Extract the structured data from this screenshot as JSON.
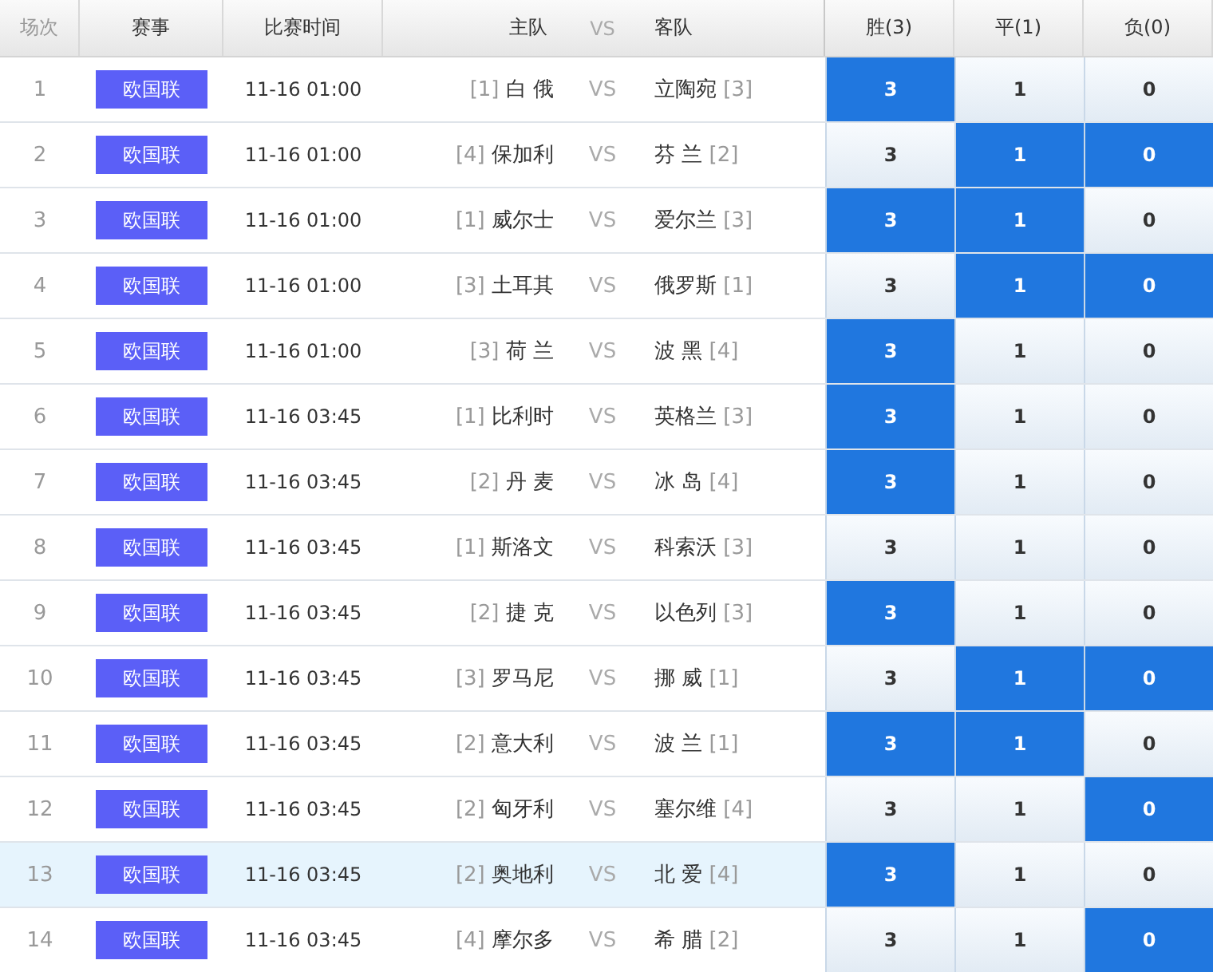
{
  "columns": [
    "场次",
    "赛事",
    "比赛时间",
    "主队",
    "VS",
    "客队",
    "胜(3)",
    "平(1)",
    "负(0)"
  ],
  "rows": [
    {
      "no": "1",
      "league": "欧国联",
      "time": "11-16 01:00",
      "home_rank": "[1]",
      "home": "白 俄",
      "vs": "VS",
      "away": "立陶宛",
      "away_rank": "[3]",
      "selected": false,
      "odds": [
        {
          "label": "3",
          "selected": true
        },
        {
          "label": "1",
          "selected": false
        },
        {
          "label": "0",
          "selected": false
        }
      ]
    },
    {
      "no": "2",
      "league": "欧国联",
      "time": "11-16 01:00",
      "home_rank": "[4]",
      "home": "保加利",
      "vs": "VS",
      "away": "芬 兰",
      "away_rank": "[2]",
      "selected": false,
      "odds": [
        {
          "label": "3",
          "selected": false
        },
        {
          "label": "1",
          "selected": true
        },
        {
          "label": "0",
          "selected": true
        }
      ]
    },
    {
      "no": "3",
      "league": "欧国联",
      "time": "11-16 01:00",
      "home_rank": "[1]",
      "home": "威尔士",
      "vs": "VS",
      "away": "爱尔兰",
      "away_rank": "[3]",
      "selected": false,
      "odds": [
        {
          "label": "3",
          "selected": true
        },
        {
          "label": "1",
          "selected": true
        },
        {
          "label": "0",
          "selected": false
        }
      ]
    },
    {
      "no": "4",
      "league": "欧国联",
      "time": "11-16 01:00",
      "home_rank": "[3]",
      "home": "土耳其",
      "vs": "VS",
      "away": "俄罗斯",
      "away_rank": "[1]",
      "selected": false,
      "odds": [
        {
          "label": "3",
          "selected": false
        },
        {
          "label": "1",
          "selected": true
        },
        {
          "label": "0",
          "selected": true
        }
      ]
    },
    {
      "no": "5",
      "league": "欧国联",
      "time": "11-16 01:00",
      "home_rank": "[3]",
      "home": "荷 兰",
      "vs": "VS",
      "away": "波 黑",
      "away_rank": "[4]",
      "selected": false,
      "odds": [
        {
          "label": "3",
          "selected": true
        },
        {
          "label": "1",
          "selected": false
        },
        {
          "label": "0",
          "selected": false
        }
      ]
    },
    {
      "no": "6",
      "league": "欧国联",
      "time": "11-16 03:45",
      "home_rank": "[1]",
      "home": "比利时",
      "vs": "VS",
      "away": "英格兰",
      "away_rank": "[3]",
      "selected": false,
      "odds": [
        {
          "label": "3",
          "selected": true
        },
        {
          "label": "1",
          "selected": false
        },
        {
          "label": "0",
          "selected": false
        }
      ]
    },
    {
      "no": "7",
      "league": "欧国联",
      "time": "11-16 03:45",
      "home_rank": "[2]",
      "home": "丹 麦",
      "vs": "VS",
      "away": "冰 岛",
      "away_rank": "[4]",
      "selected": false,
      "odds": [
        {
          "label": "3",
          "selected": true
        },
        {
          "label": "1",
          "selected": false
        },
        {
          "label": "0",
          "selected": false
        }
      ]
    },
    {
      "no": "8",
      "league": "欧国联",
      "time": "11-16 03:45",
      "home_rank": "[1]",
      "home": "斯洛文",
      "vs": "VS",
      "away": "科索沃",
      "away_rank": "[3]",
      "selected": false,
      "odds": [
        {
          "label": "3",
          "selected": false
        },
        {
          "label": "1",
          "selected": false
        },
        {
          "label": "0",
          "selected": false
        }
      ]
    },
    {
      "no": "9",
      "league": "欧国联",
      "time": "11-16 03:45",
      "home_rank": "[2]",
      "home": "捷 克",
      "vs": "VS",
      "away": "以色列",
      "away_rank": "[3]",
      "selected": false,
      "odds": [
        {
          "label": "3",
          "selected": true
        },
        {
          "label": "1",
          "selected": false
        },
        {
          "label": "0",
          "selected": false
        }
      ]
    },
    {
      "no": "10",
      "league": "欧国联",
      "time": "11-16 03:45",
      "home_rank": "[3]",
      "home": "罗马尼",
      "vs": "VS",
      "away": "挪 威",
      "away_rank": "[1]",
      "selected": false,
      "odds": [
        {
          "label": "3",
          "selected": false
        },
        {
          "label": "1",
          "selected": true
        },
        {
          "label": "0",
          "selected": true
        }
      ]
    },
    {
      "no": "11",
      "league": "欧国联",
      "time": "11-16 03:45",
      "home_rank": "[2]",
      "home": "意大利",
      "vs": "VS",
      "away": "波 兰",
      "away_rank": "[1]",
      "selected": false,
      "odds": [
        {
          "label": "3",
          "selected": true
        },
        {
          "label": "1",
          "selected": true
        },
        {
          "label": "0",
          "selected": false
        }
      ]
    },
    {
      "no": "12",
      "league": "欧国联",
      "time": "11-16 03:45",
      "home_rank": "[2]",
      "home": "匈牙利",
      "vs": "VS",
      "away": "塞尔维",
      "away_rank": "[4]",
      "selected": false,
      "odds": [
        {
          "label": "3",
          "selected": false
        },
        {
          "label": "1",
          "selected": false
        },
        {
          "label": "0",
          "selected": true
        }
      ]
    },
    {
      "no": "13",
      "league": "欧国联",
      "time": "11-16 03:45",
      "home_rank": "[2]",
      "home": "奥地利",
      "vs": "VS",
      "away": "北 爱",
      "away_rank": "[4]",
      "selected": true,
      "odds": [
        {
          "label": "3",
          "selected": true
        },
        {
          "label": "1",
          "selected": false
        },
        {
          "label": "0",
          "selected": false
        }
      ]
    },
    {
      "no": "14",
      "league": "欧国联",
      "time": "11-16 03:45",
      "home_rank": "[4]",
      "home": "摩尔多",
      "vs": "VS",
      "away": "希 腊",
      "away_rank": "[2]",
      "selected": false,
      "odds": [
        {
          "label": "3",
          "selected": false
        },
        {
          "label": "1",
          "selected": false
        },
        {
          "label": "0",
          "selected": true
        }
      ]
    }
  ]
}
